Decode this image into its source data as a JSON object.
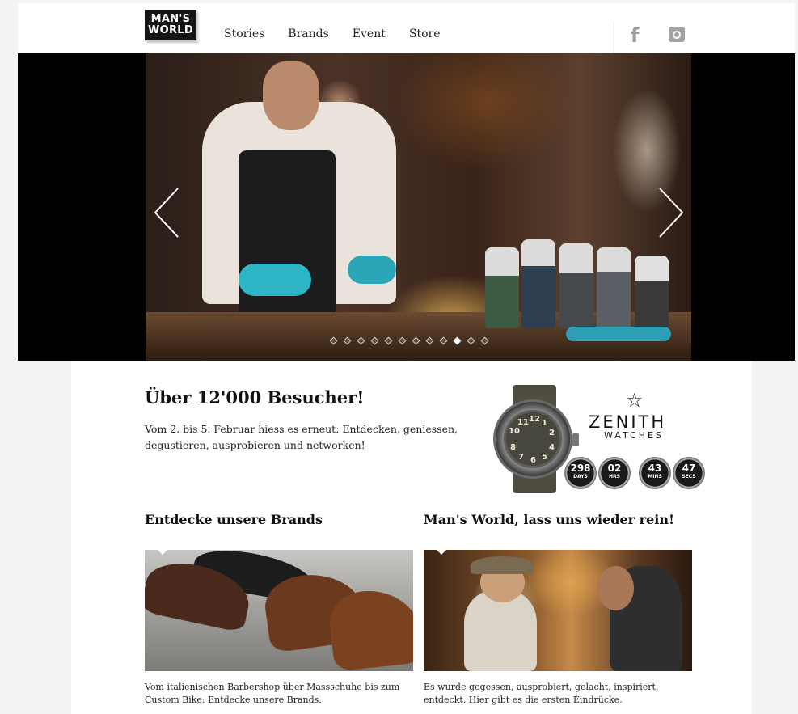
{
  "header": {
    "logo_line1": "MAN'S",
    "logo_line2": "WORLD",
    "nav": [
      "Stories",
      "Brands",
      "Event",
      "Store"
    ],
    "social": [
      "facebook-icon",
      "instagram-icon"
    ]
  },
  "hero": {
    "slide_count": 12,
    "active_slide": 9,
    "prev_icon": "chevron-left-icon",
    "next_icon": "chevron-right-icon"
  },
  "intro": {
    "title": "Über 12'000 Besucher!",
    "text": "Vom 2. bis 5. Februar hiess es erneut: Entdecken, geniessen, degustieren, ausprobieren und networken!"
  },
  "ad": {
    "brand": "ZENITH",
    "brand_sub": "WATCHES",
    "dial_numbers": [
      "12",
      "1",
      "2",
      "4",
      "5",
      "6",
      "7",
      "8",
      "10",
      "11"
    ],
    "countdown": [
      {
        "value": "298",
        "label": "DAYS"
      },
      {
        "value": "02",
        "label": "HRS"
      },
      {
        "value": "43",
        "label": "MINS"
      },
      {
        "value": "47",
        "label": "SECS"
      }
    ]
  },
  "sections": {
    "brands_title": "Entdecke unsere Brands",
    "brands_text": "Vom italienischen Barbershop über Massschuhe bis zum Custom Bike: Entdecke unsere Brands.",
    "event_title": "Man's World, lass uns wieder rein!",
    "event_text": "Es wurde gegessen, ausprobiert, gelacht, inspiriert, entdeckt. Hier gibt es die ersten Eindrücke."
  },
  "colors": {
    "page_bg": "#f3f3f3",
    "logo_bg": "#141414",
    "icon_gray": "#9b9b9b"
  }
}
